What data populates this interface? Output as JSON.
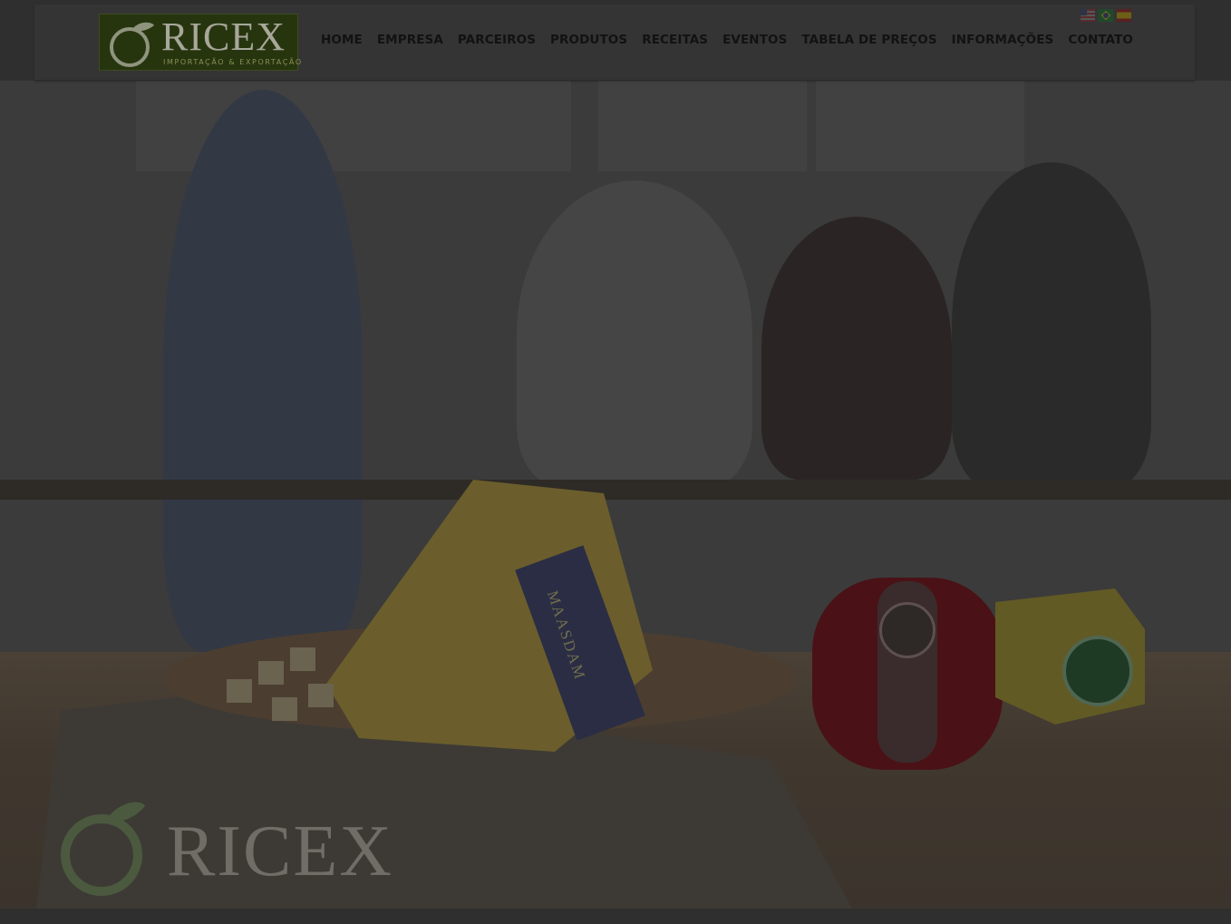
{
  "brand": {
    "name": "RICEX",
    "tagline": "IMPORTAÇÃO & EXPORTAÇÃO"
  },
  "nav": {
    "items": [
      {
        "label": "HOME"
      },
      {
        "label": "EMPRESA"
      },
      {
        "label": "PARCEIROS"
      },
      {
        "label": "PRODUTOS"
      },
      {
        "label": "RECEITAS"
      },
      {
        "label": "EVENTOS"
      },
      {
        "label": "TABELA DE PREÇOS"
      },
      {
        "label": "INFORMAÇÕES"
      },
      {
        "label": "CONTATO"
      }
    ]
  },
  "languages": [
    {
      "icon": "us-flag-icon"
    },
    {
      "icon": "brazil-flag-icon"
    },
    {
      "icon": "spain-flag-icon"
    }
  ],
  "hero": {
    "cheese_label": "MAASDAM",
    "watermark": "RICEX"
  },
  "colors": {
    "overlay": "#2f2f2f",
    "logo_bg": "#27350f",
    "nav_text": "#121212"
  }
}
